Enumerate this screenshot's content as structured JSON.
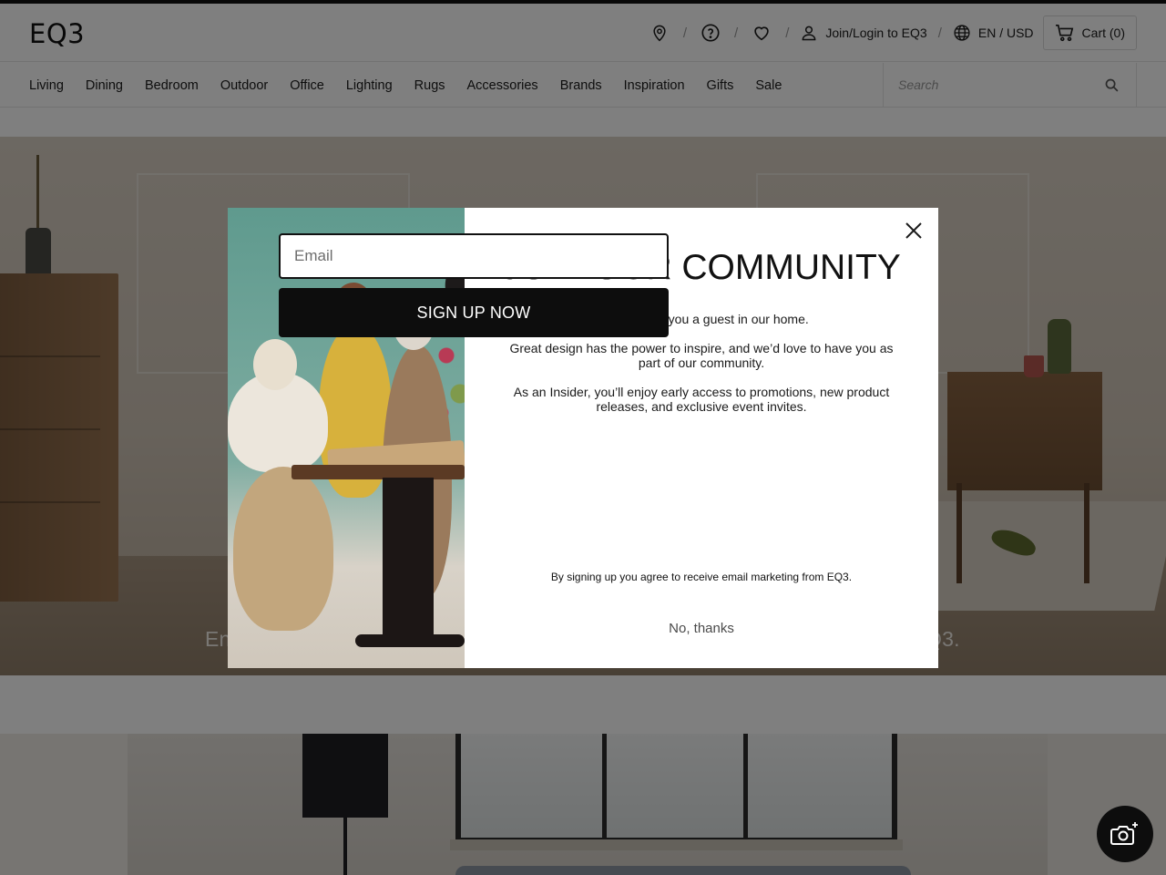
{
  "header": {
    "logo": "EQ3",
    "separator": "/",
    "login_label": "Join/Login to EQ3",
    "locale_label": "EN / USD",
    "cart_label": "Cart (0)",
    "icons": [
      "location-pin-icon",
      "help-icon",
      "heart-icon",
      "user-icon",
      "globe-icon",
      "cart-icon"
    ]
  },
  "nav": {
    "items": [
      "Living",
      "Dining",
      "Bedroom",
      "Outdoor",
      "Office",
      "Lighting",
      "Rugs",
      "Accessories",
      "Brands",
      "Inspiration",
      "Gifts",
      "Sale"
    ],
    "search_placeholder": "Search"
  },
  "hero": {
    "caption_left": "En",
    "caption_right": "Q3."
  },
  "modal": {
    "title": "JOIN OUR COMMUNITY",
    "paragraph_1": "We consider you a guest in our home.",
    "paragraph_2": "Great design has the power to inspire, and we’d love to have you as part of our community.",
    "paragraph_3": "As an Insider, you’ll enjoy early access to promotions, new product releases, and exclusive event invites.",
    "email_placeholder": "Email",
    "email_value": "",
    "signup_label": "SIGN UP NOW",
    "legal_text": "By signing up you agree to receive email marketing from EQ3.",
    "decline_label": "No, thanks"
  },
  "colors": {
    "primary_dark": "#0d0d0d",
    "overlay": "rgba(0,0,0,0.5)",
    "border": "#e4e4e4"
  }
}
